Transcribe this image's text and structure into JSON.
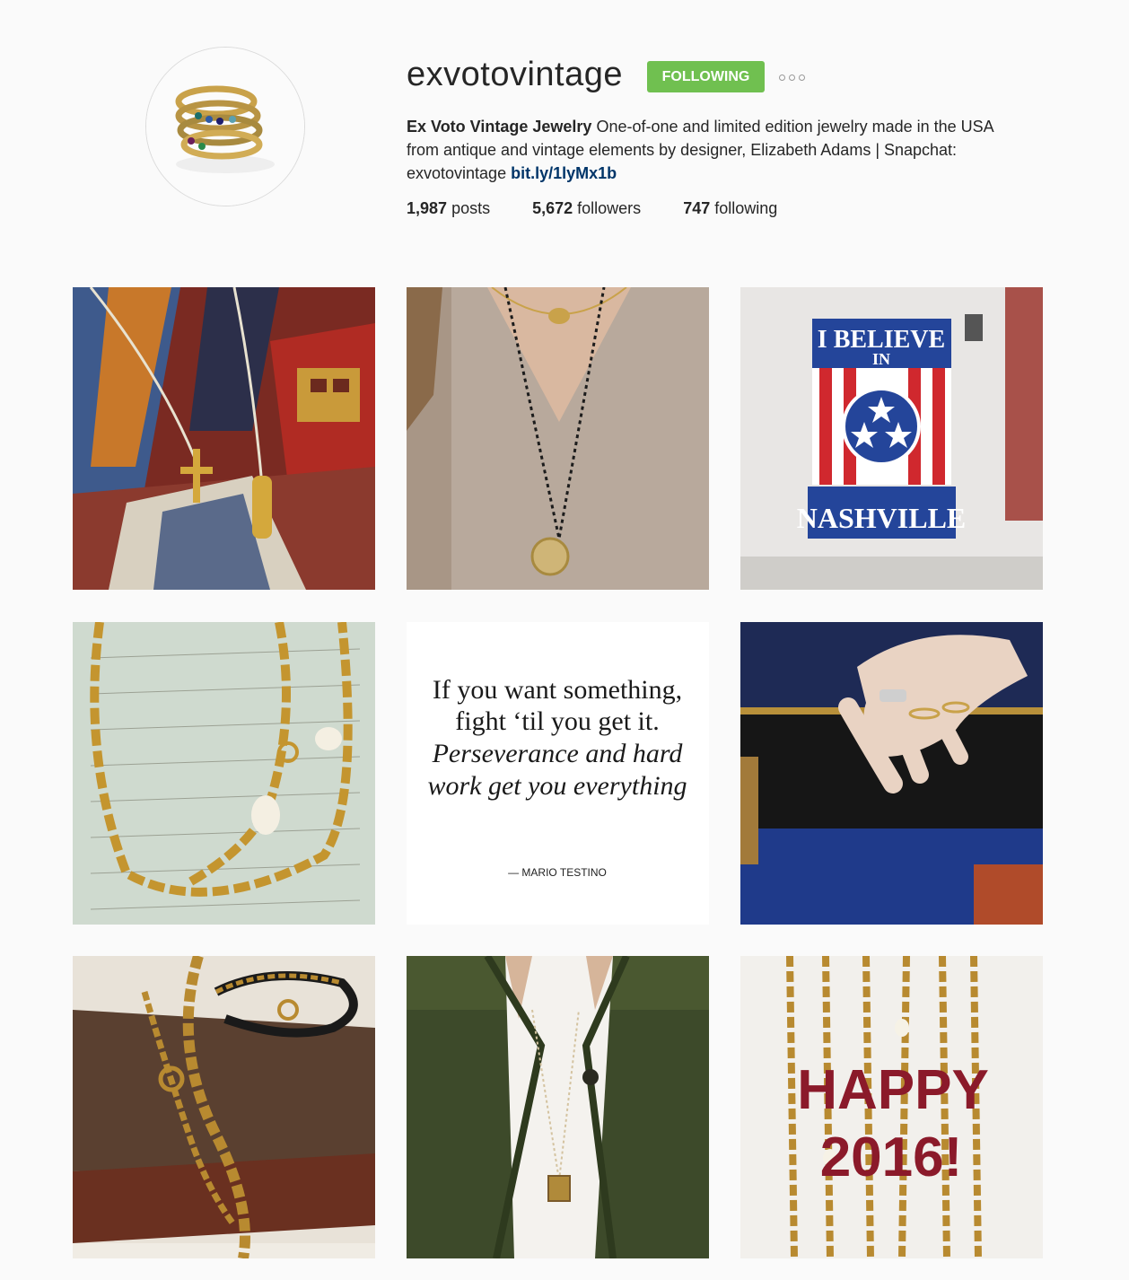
{
  "profile": {
    "username": "exvotovintage",
    "follow_label": "FOLLOWING",
    "more_icon": "more-options-icon",
    "bio_name": "Ex Voto Vintage Jewelry",
    "bio_line1": "One-of-one and limited edition jewelry made in the USA",
    "bio_line2": "from antique and vintage elements by designer, Elizabeth Adams | Snapchat:",
    "bio_line3": "exvotovintage",
    "bio_link": "bit.ly/1lyMx1b",
    "posts_count": "1,987",
    "posts_label": "posts",
    "followers_count": "5,672",
    "followers_label": "followers",
    "following_count": "747",
    "following_label": "following"
  },
  "colors": {
    "follow_green": "#70c050",
    "link_blue": "#003569",
    "background": "#fafafa"
  },
  "posts": {
    "nashville_line1": "I BELIEVE",
    "nashville_line2": "IN",
    "nashville_line3": "NASHVILLE",
    "quote_line1": "If you want something,",
    "quote_line2": "fight ‘til you get it.",
    "quote_line3": "Perseverance and hard",
    "quote_line4": "work get you everything",
    "quote_author": "— MARIO TESTINO",
    "newyear_line1": "HAPPY",
    "newyear_line2": "2016!"
  }
}
